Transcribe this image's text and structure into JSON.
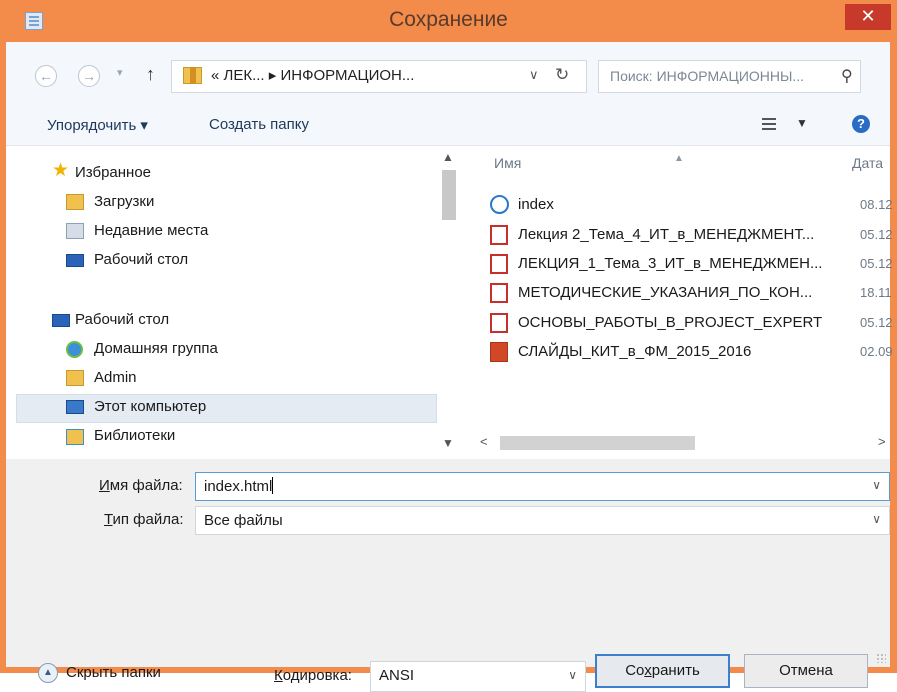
{
  "window": {
    "title": "Сохранение",
    "close_glyph": "✕"
  },
  "address_bar": {
    "back_glyph": "←",
    "forward_glyph": "→",
    "up_glyph": "↑",
    "breadcrumb_text": "«  ЛЕК...  ▸  ИНФОРМАЦИОН...",
    "search_placeholder": "Поиск: ИНФОРМАЦИОННЫ..."
  },
  "toolbar": {
    "organize_label": "Упорядочить ▾",
    "new_folder_label": "Создать папку"
  },
  "nav_pane": {
    "items": [
      {
        "label": "Избранное",
        "icon": "star-icon"
      },
      {
        "label": "Загрузки",
        "icon": "downloads-folder-icon"
      },
      {
        "label": "Недавние места",
        "icon": "recent-places-icon"
      },
      {
        "label": "Рабочий стол",
        "icon": "desktop-icon"
      },
      {
        "label": "Рабочий стол",
        "icon": "desktop-icon"
      },
      {
        "label": "Домашняя группа",
        "icon": "homegroup-icon"
      },
      {
        "label": "Admin",
        "icon": "user-folder-icon"
      },
      {
        "label": "Этот компьютер",
        "icon": "computer-icon",
        "selected": true
      },
      {
        "label": "Библиотеки",
        "icon": "libraries-icon"
      }
    ]
  },
  "file_list": {
    "columns": {
      "name": "Имя",
      "date": "Дата"
    },
    "files": [
      {
        "name": "index",
        "date": "08.12",
        "icon": "html-file-icon"
      },
      {
        "name": "Лекция 2_Тема_4_ИТ_в_МЕНЕДЖМЕНТ...",
        "date": "05.12",
        "icon": "pdf-file-icon"
      },
      {
        "name": "ЛЕКЦИЯ_1_Тема_3_ИТ_в_МЕНЕДЖМЕН...",
        "date": "05.12",
        "icon": "pdf-file-icon"
      },
      {
        "name": "МЕТОДИЧЕСКИЕ_УКАЗАНИЯ_ПО_КОН...",
        "date": "18.11",
        "icon": "pdf-file-icon"
      },
      {
        "name": "ОСНОВЫ_РАБОТЫ_В_PROJECT_EXPERT",
        "date": "05.12",
        "icon": "pdf-file-icon"
      },
      {
        "name": "СЛАЙДЫ_КИТ_в_ФМ_2015_2016",
        "date": "02.09",
        "icon": "pptx-file-icon"
      }
    ]
  },
  "form": {
    "filename_label_u": "И",
    "filename_label_rest": "мя файла:",
    "filename_value": "index.html",
    "filetype_label_u": "Т",
    "filetype_label_rest": "ип файла:",
    "filetype_value": "Все файлы",
    "encoding_label_u": "К",
    "encoding_label_rest": "одировка:",
    "encoding_value": "ANSI"
  },
  "footer": {
    "hide_folders_label": "Скрыть папки",
    "save_label_pre": "Со",
    "save_label_u": "х",
    "save_label_post": "ранить",
    "cancel_label": "Отмена"
  },
  "colors": {
    "title_bar": "#f38b4b",
    "close_button": "#c7392b",
    "focus_border": "#5b9bd5",
    "selection": "#e5ebf2"
  }
}
